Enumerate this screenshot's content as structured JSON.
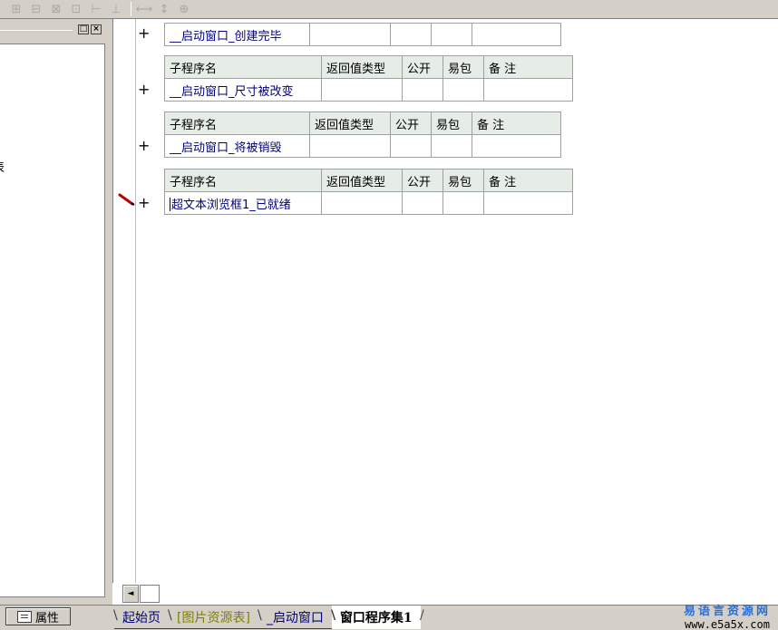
{
  "toolbar": {
    "icons": [
      "align-left-icon",
      "align-center-icon",
      "align-top-icon",
      "align-right-icon",
      "equal-width-icon",
      "equal-height-icon",
      "stretch-width-icon",
      "stretch-height-icon",
      "center-both-icon"
    ],
    "glyphs": [
      "⊞",
      "⊟",
      "⊠",
      "⊡",
      "⊢",
      "⊥",
      "⟷",
      "↕",
      "⊕"
    ]
  },
  "left_panel": {
    "controls": [
      "□",
      "×"
    ],
    "cut_text": "表"
  },
  "code": {
    "header": {
      "name": "子程序名",
      "return_type": "返回值类型",
      "public": "公开",
      "easy_pack": "易包",
      "note": "备 注"
    },
    "subs": [
      {
        "name": "__启动窗口_创建完毕",
        "show_header": false
      },
      {
        "name": "__启动窗口_尺寸被改变",
        "show_header": true
      },
      {
        "name": "__启动窗口_将被销毁",
        "show_header": true
      },
      {
        "name": "超文本浏览框1_已就绪",
        "show_header": true
      }
    ],
    "plus": "+"
  },
  "bottom": {
    "property_button": "属性",
    "tabs": [
      "起始页",
      "[图片资源表]",
      "_启动窗口",
      "窗口程序集1"
    ],
    "active_tab": "窗口程序集1",
    "scroll_left": "◄"
  },
  "watermark": {
    "cn": "易语言资源网",
    "url": "www.e5a5x.com"
  }
}
